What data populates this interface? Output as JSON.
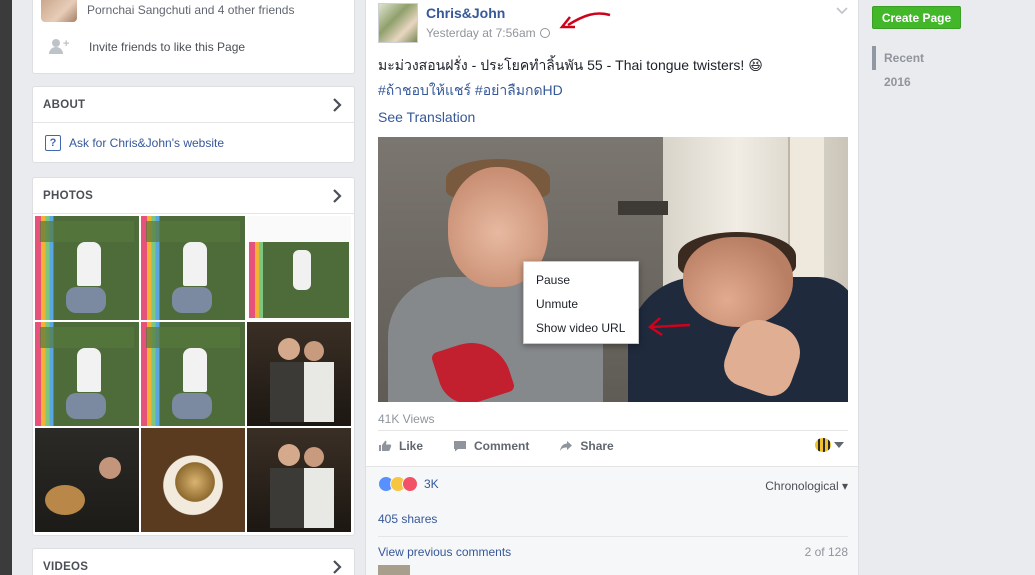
{
  "left_column": {
    "friends_likes_text": "Pornchai Sangchuti and 4 other friends",
    "invite_text": "Invite friends to like this Page",
    "about": {
      "title": "ABOUT",
      "website_link": "Ask for Chris&John's website"
    },
    "photos": {
      "title": "PHOTOS"
    },
    "videos": {
      "title": "VIDEOS"
    }
  },
  "post": {
    "author": "Chris&John",
    "timestamp": "Yesterday at 7:56am",
    "text": "มะม่วงสอนฝรั่ง - ประโยคทำลิ้นพัน 55 - Thai tongue twisters! 😆",
    "hashtags": "#ถ้าชอบให้แชร์ #อย่าลืมกดHD",
    "see_translation": "See Translation",
    "video_menu": {
      "items": [
        "Pause",
        "Unmute",
        "Show video URL"
      ]
    },
    "views": "41K Views",
    "actions": {
      "like": "Like",
      "comment": "Comment",
      "share": "Share"
    },
    "reaction_count": "3K",
    "sort_label": "Chronological",
    "shares": "405 shares",
    "view_previous_comments": "View previous comments",
    "comment_count": "2 of 128"
  },
  "right_column": {
    "create_page_button": "Create Page",
    "timeline": [
      "Recent",
      "2016"
    ]
  },
  "colors": {
    "facebook_blue": "#365899",
    "create_green": "#42b72a",
    "annotation_red": "#d0021b",
    "background": "#e9ebee"
  }
}
